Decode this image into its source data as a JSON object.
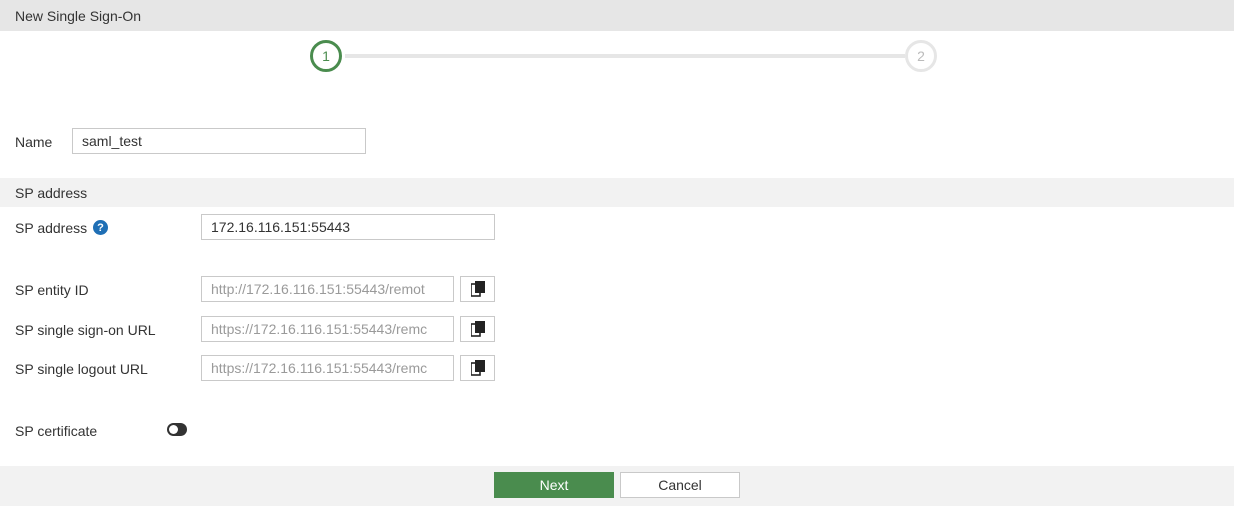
{
  "window": {
    "title": "New Single Sign-On"
  },
  "stepper": {
    "step1": "1",
    "step2": "2",
    "active_step": 1
  },
  "form": {
    "name_label": "Name",
    "name_value": "saml_test",
    "section_title": "SP address",
    "sp_address_label": "SP address",
    "sp_address_value": "172.16.116.151:55443",
    "sp_entity_id_label": "SP entity ID",
    "sp_entity_id_value": "http://172.16.116.151:55443/remot",
    "sp_sso_url_label": "SP single sign-on URL",
    "sp_sso_url_value": "https://172.16.116.151:55443/remc",
    "sp_slo_url_label": "SP single logout URL",
    "sp_slo_url_value": "https://172.16.116.151:55443/remc",
    "sp_certificate_label": "SP certificate",
    "sp_certificate_enabled": false
  },
  "icons": {
    "help": "question-circle-icon",
    "copy": "copy-icon"
  },
  "footer": {
    "next_label": "Next",
    "cancel_label": "Cancel"
  },
  "colors": {
    "accent": "#4a8c4e",
    "help": "#1f6fb5"
  }
}
